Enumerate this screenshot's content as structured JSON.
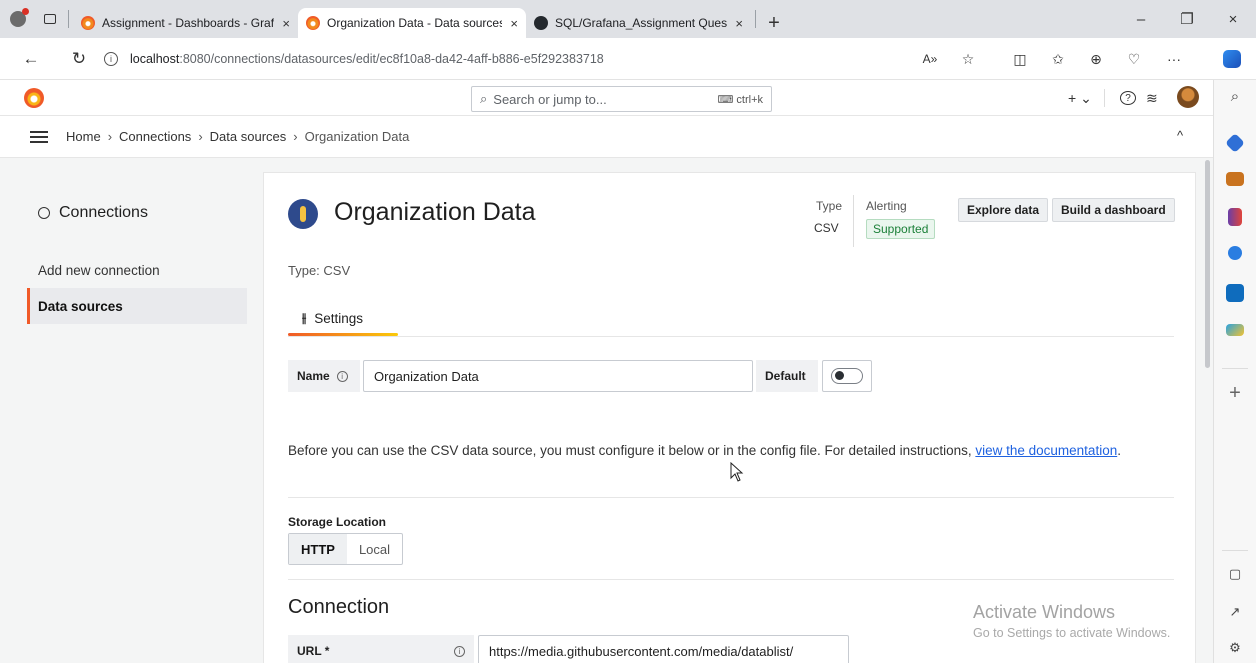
{
  "browser": {
    "tabs": [
      {
        "label": "Assignment - Dashboards - Grafa",
        "icon": "grafana-icon",
        "active": false
      },
      {
        "label": "Organization Data - Data sources",
        "icon": "grafana-icon",
        "active": true
      },
      {
        "label": "SQL/Grafana_Assignment Questi",
        "icon": "github-icon",
        "active": false
      }
    ],
    "tab_close_glyph": "×",
    "new_tab_glyph": "+",
    "window_controls": {
      "minimize": "–",
      "restore": "❐",
      "close": "×"
    },
    "url_host": "localhost",
    "url_path": ":8080/connections/datasources/edit/ec8f10a8-da42-4aff-b886-e5f292383718",
    "read_aloud": "A»",
    "more": "···"
  },
  "grafana": {
    "search_placeholder": "Search or jump to...",
    "search_shortcut": "⌨ ctrl+k",
    "new_button": "+ ⌄",
    "help_glyph": "?",
    "news_glyph": "≋",
    "breadcrumbs": [
      "Home",
      "Connections",
      "Data sources",
      "Organization Data"
    ],
    "crumb_sep": "›",
    "collapse_glyph": "^",
    "nav": {
      "title": "Connections",
      "items": [
        {
          "label": "Add new connection",
          "active": false
        },
        {
          "label": "Data sources",
          "active": true
        }
      ]
    },
    "datasource": {
      "title": "Organization Data",
      "type_label": "Type",
      "type_value": "CSV",
      "alerting_label": "Alerting",
      "alerting_badge": "Supported",
      "explore_button": "Explore data",
      "build_button": "Build a dashboard",
      "typeline": "Type: CSV",
      "settings_tab": "Settings",
      "name_label": "Name",
      "name_value": "Organization Data",
      "default_label": "Default",
      "default_enabled": false,
      "info_text": "Before you can use the CSV data source, you must configure it below or in the config file. For detailed instructions, ",
      "info_link": "view the documentation",
      "info_end": ".",
      "storage_label": "Storage Location",
      "storage_options": [
        "HTTP",
        "Local"
      ],
      "storage_selected": "HTTP",
      "connection_title": "Connection",
      "url_label": "URL *",
      "url_value": "https://media.githubusercontent.com/media/datablist/"
    }
  },
  "watermark": {
    "line1": "Activate Windows",
    "line2": "Go to Settings to activate Windows."
  },
  "colors": {
    "accent": "#f05a28",
    "link": "#1f62e0",
    "supported": "#1a7f37"
  }
}
